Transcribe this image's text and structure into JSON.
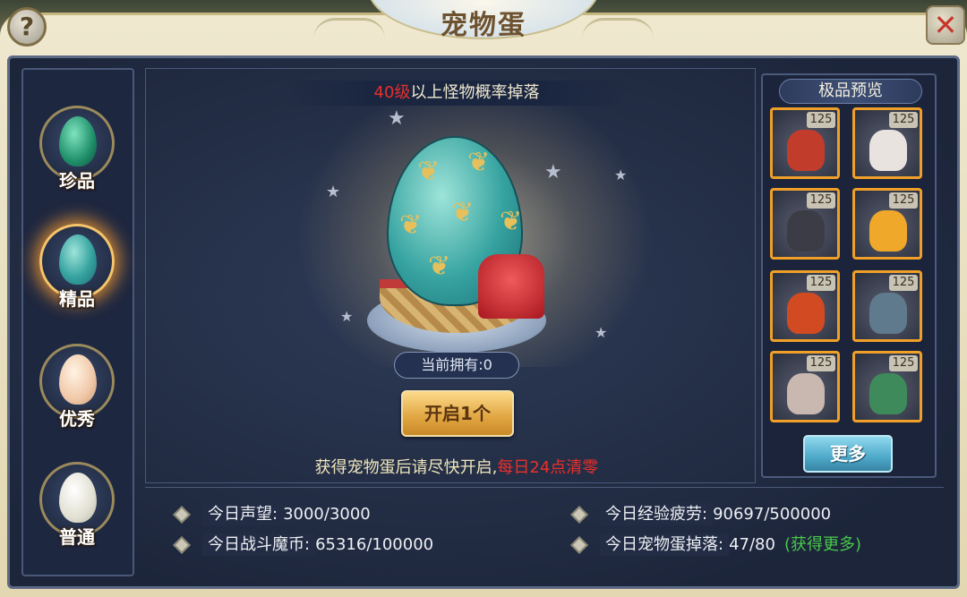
{
  "header": {
    "title": "宠物蛋",
    "help_icon": "?",
    "close_icon": "✕"
  },
  "tabs": [
    {
      "label": "珍品",
      "egg_color": "#2fae8a",
      "active": false
    },
    {
      "label": "精品",
      "egg_color": "#3aa8a0",
      "active": true
    },
    {
      "label": "优秀",
      "egg_color": "#f0d2b4",
      "active": false
    },
    {
      "label": "普通",
      "egg_color": "#e9e7dc",
      "active": false
    }
  ],
  "drop_info": {
    "level": "40级",
    "text": "以上怪物概率掉落"
  },
  "owned": "当前拥有:0",
  "open_button": "开启1个",
  "hint": {
    "text": "获得宠物蛋后请尽快开启,",
    "warning": "每日24点清零"
  },
  "preview": {
    "title": "极品预览",
    "pets": [
      {
        "level": "125",
        "color": "#c23c2c"
      },
      {
        "level": "125",
        "color": "#e9e3e0"
      },
      {
        "level": "125",
        "color": "#3c3c46"
      },
      {
        "level": "125",
        "color": "#f0a82a"
      },
      {
        "level": "125",
        "color": "#d24a22"
      },
      {
        "level": "125",
        "color": "#5f7a8c"
      },
      {
        "level": "125",
        "color": "#c8b8b0"
      },
      {
        "level": "125",
        "color": "#3e8a5a"
      }
    ],
    "more_button": "更多"
  },
  "stats": {
    "prestige": {
      "label": "今日声望:",
      "value": "3000/3000"
    },
    "coins": {
      "label": "今日战斗魔币:",
      "value": "65316/100000"
    },
    "fatigue": {
      "label": "今日经验疲劳:",
      "value": "90697/500000"
    },
    "egg_drop": {
      "label": "今日宠物蛋掉落:",
      "value": "47/80",
      "link": "(获得更多)"
    }
  }
}
